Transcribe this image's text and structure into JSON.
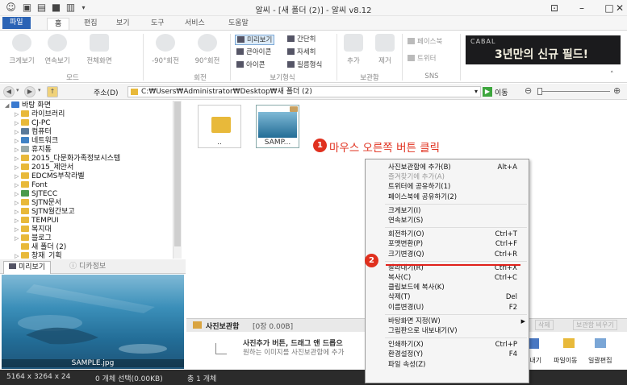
{
  "app": {
    "title": "알씨 - [새 폴더 (2)] - 알씨 v8.12"
  },
  "tabs": [
    {
      "label": "파일"
    },
    {
      "label": "홈"
    },
    {
      "label": "편집"
    },
    {
      "label": "보기"
    },
    {
      "label": "도구"
    },
    {
      "label": "서비스"
    },
    {
      "label": "도움말"
    }
  ],
  "ribbon": {
    "mode": {
      "items": [
        "크게보기",
        "연속보기",
        "전체화면"
      ],
      "group": "모드"
    },
    "rotate": {
      "items": [
        "-90°회전",
        "90°회전"
      ],
      "group": "회전"
    },
    "view": {
      "items": [
        "미리보기",
        "간단히",
        "큰아이콘",
        "자세히",
        "아이콘",
        "필름형식"
      ],
      "group": "보기형식"
    },
    "album": {
      "items": [
        "추가",
        "제거"
      ],
      "group": "보관함"
    },
    "sns": {
      "items": [
        "페이스북",
        "트위터"
      ],
      "group": "SNS"
    },
    "ad": {
      "brand": "CABAL",
      "slogan": "3년만의 신규 필드!"
    }
  },
  "addressbar": {
    "label": "주소(D)",
    "path": "C:₩Users₩Administrator₩Desktop₩새 폴더 (2)",
    "go": "이동"
  },
  "tree": [
    {
      "label": "바탕 화면",
      "level": 0
    },
    {
      "label": "라이브러리",
      "level": 1
    },
    {
      "label": "CJ-PC",
      "level": 1
    },
    {
      "label": "컴퓨터",
      "level": 1
    },
    {
      "label": "네트워크",
      "level": 1
    },
    {
      "label": "휴지통",
      "level": 1
    },
    {
      "label": "2015_다문화가족정보시스템",
      "level": 1
    },
    {
      "label": "2015_제안서",
      "level": 1
    },
    {
      "label": "EDCMS부착라벨",
      "level": 1
    },
    {
      "label": "Font",
      "level": 1
    },
    {
      "label": "SJTECC",
      "level": 1
    },
    {
      "label": "SJTN문서",
      "level": 1
    },
    {
      "label": "SJTN월간보고",
      "level": 1
    },
    {
      "label": "TEMPUI",
      "level": 1
    },
    {
      "label": "복지대",
      "level": 1
    },
    {
      "label": "블로그",
      "level": 1
    },
    {
      "label": "새 폴더 (2)",
      "level": 1
    },
    {
      "label": "창재_기획",
      "level": 1
    }
  ],
  "preview": {
    "tabs": [
      "미리보기",
      "디카정보"
    ],
    "filename": "SAMPLE.jpg"
  },
  "files": [
    {
      "name": ".."
    },
    {
      "name": "SAMP..."
    }
  ],
  "callouts": [
    {
      "num": "1",
      "text": "마우스 오른쪽 버튼 클릭"
    },
    {
      "num": "2"
    }
  ],
  "album": {
    "title": "사진보관함",
    "info": "[0장 0.00B]",
    "hint1": "사진추가 버튼, 드래그 앤 드롭으",
    "hint2": "원하는 이미지를 사진보관함에 추가",
    "right": [
      "파일이동",
      "일괄편집"
    ],
    "right0": "보내기",
    "btns": [
      "삭제",
      "보관함 비우기"
    ]
  },
  "status": {
    "dims": "5164 x 3264 x 24",
    "selected": "0 개체 선택(0.00KB)",
    "total": "총 1 개체"
  },
  "menu": [
    {
      "label": "사진보관함에 추가(B)",
      "shortcut": "Alt+A"
    },
    {
      "label": "즐겨찾기에 추가(A)",
      "shortcut": "",
      "disabled": true
    },
    {
      "label": "트위터에 공유하기(1)",
      "shortcut": ""
    },
    {
      "label": "페이스북에 공유하기(2)",
      "shortcut": ""
    },
    {
      "sep": true
    },
    {
      "label": "크게보기(I)",
      "shortcut": ""
    },
    {
      "label": "연속보기(S)",
      "shortcut": ""
    },
    {
      "sep": true
    },
    {
      "label": "회전하기(O)",
      "shortcut": "Ctrl+T"
    },
    {
      "label": "포맷변환(P)",
      "shortcut": "Ctrl+F"
    },
    {
      "label": "크기변경(Q)",
      "shortcut": "Ctrl+R"
    },
    {
      "sep": true
    },
    {
      "label": "잘라내기(R)",
      "shortcut": "Ctrl+X"
    },
    {
      "label": "복사(C)",
      "shortcut": "Ctrl+C"
    },
    {
      "label": "클립보드에 복사(K)",
      "shortcut": ""
    },
    {
      "label": "삭제(T)",
      "shortcut": "Del"
    },
    {
      "label": "이름변경(U)",
      "shortcut": "F2"
    },
    {
      "sep": true
    },
    {
      "label": "바탕화면 지정(W)",
      "shortcut": "",
      "submenu": true
    },
    {
      "label": "그림판으로 내보내기(V)",
      "shortcut": ""
    },
    {
      "sep": true
    },
    {
      "label": "인쇄하기(X)",
      "shortcut": "Ctrl+P"
    },
    {
      "label": "환경설정(Y)",
      "shortcut": "F4"
    },
    {
      "label": "파일 속성(Z)",
      "shortcut": ""
    }
  ],
  "colors": {
    "accent": "#2a63b5",
    "callout": "#e0301e"
  }
}
